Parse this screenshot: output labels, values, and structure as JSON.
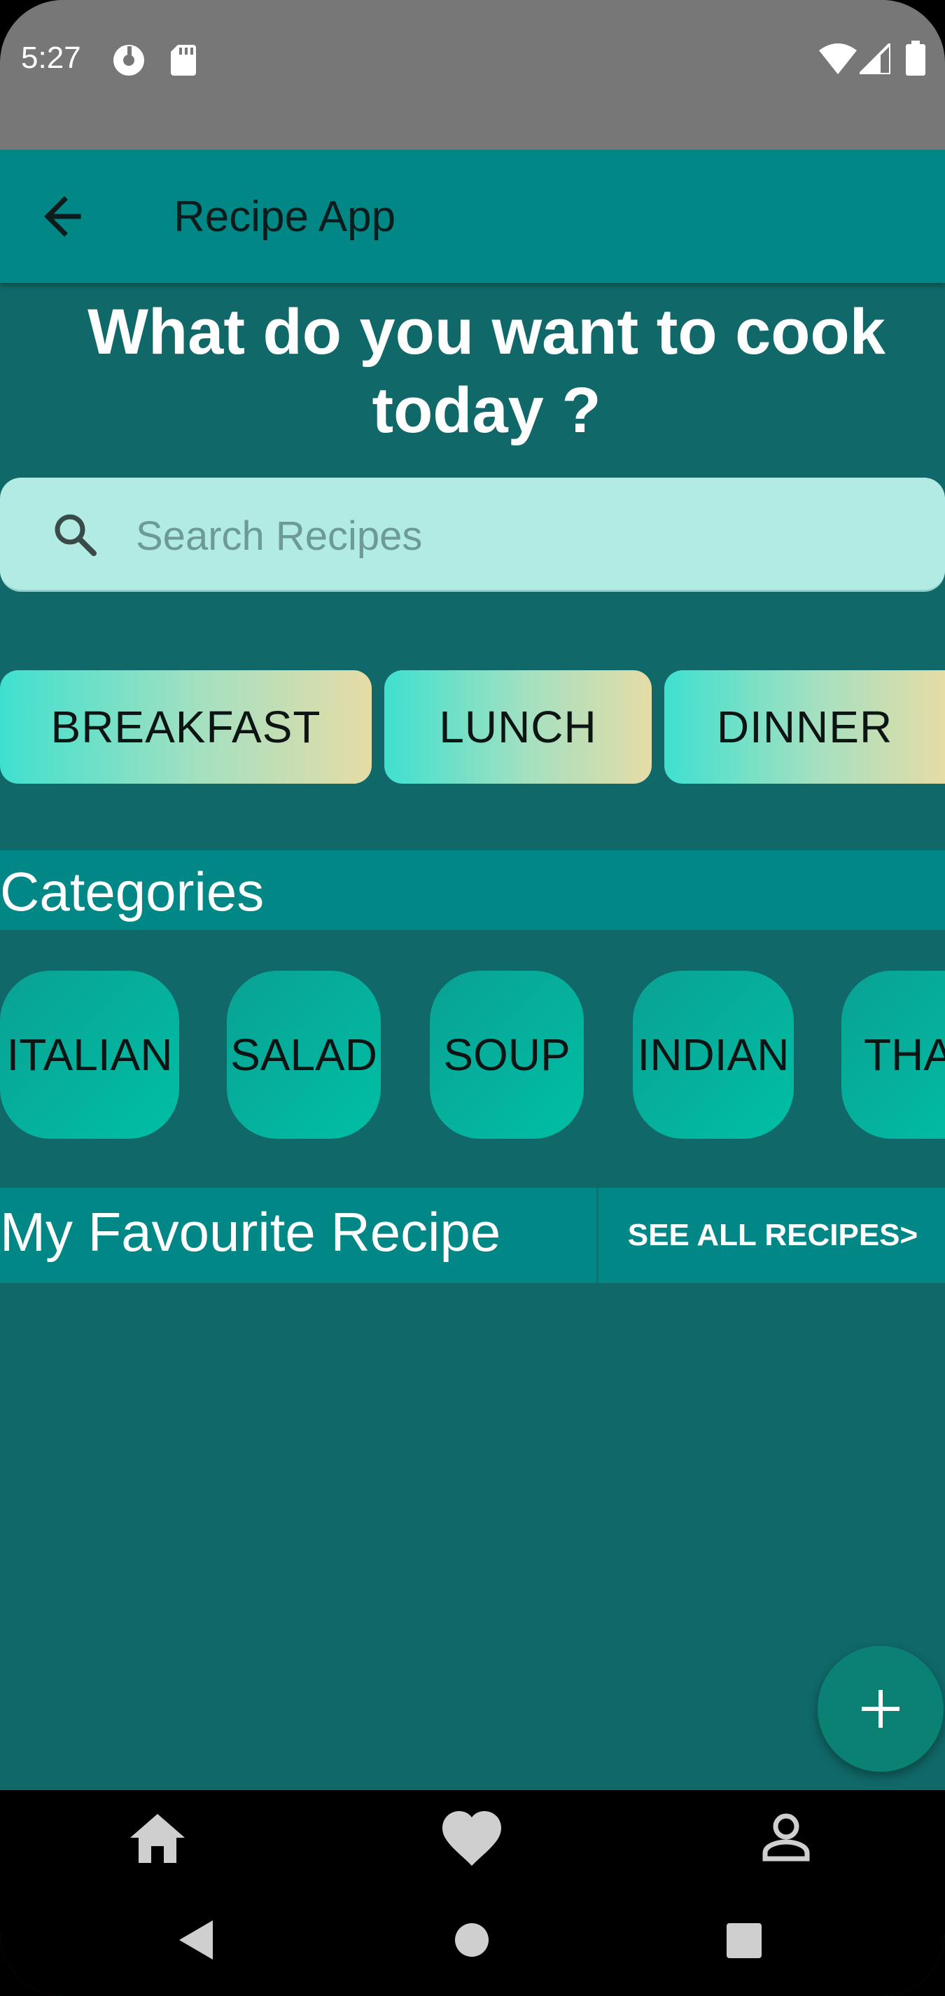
{
  "status_bar": {
    "time": "5:27",
    "icons": [
      "app-notification-icon",
      "sd-card-icon",
      "wifi-icon",
      "cell-signal-icon",
      "battery-icon"
    ]
  },
  "app_bar": {
    "title": "Recipe App",
    "back_icon": "arrow-left-icon"
  },
  "headline": "What do you want to cook today ?",
  "search": {
    "placeholder": "Search Recipes",
    "value": "",
    "icon": "search-icon"
  },
  "meal_buttons": [
    "BREAKFAST",
    "LUNCH",
    "DINNER"
  ],
  "categories": {
    "title": "Categories",
    "items": [
      "ITALIAN",
      "SALAD",
      "SOUP",
      "INDIAN",
      "THAI"
    ]
  },
  "favourites": {
    "title": "My Favourite Recipe",
    "see_all": "SEE ALL RECIPES>"
  },
  "fab_icon": "plus-icon",
  "bottom_nav": [
    "home-icon",
    "heart-icon",
    "profile-icon"
  ],
  "system_nav": [
    "back-triangle-icon",
    "home-circle-icon",
    "recents-square-icon"
  ],
  "colors": {
    "background": "#106868",
    "app_bar": "#018786",
    "status_bar": "#777777",
    "search_box": "#b2ebe4",
    "fab": "#0b8173"
  }
}
